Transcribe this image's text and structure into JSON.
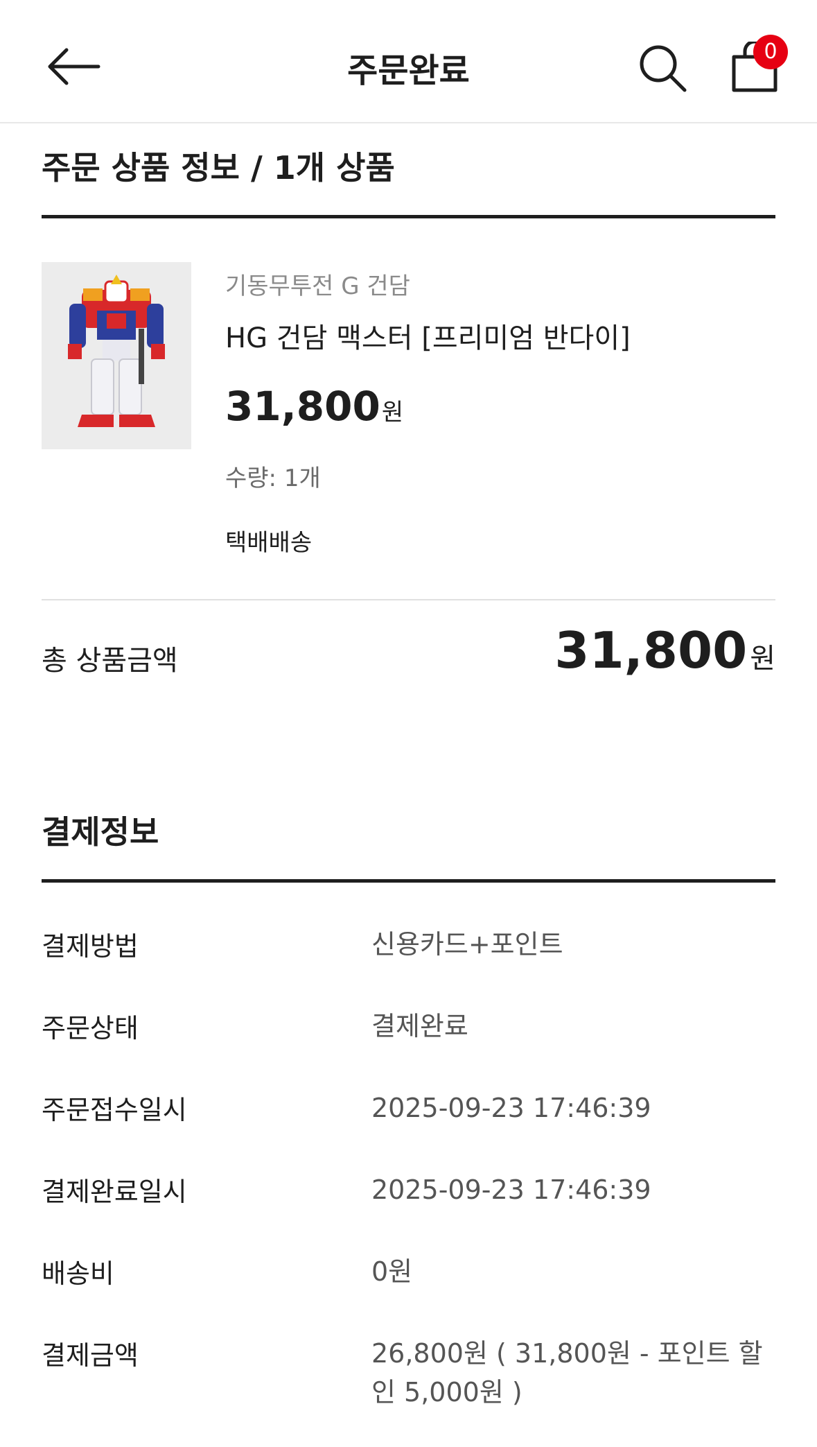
{
  "header": {
    "title": "주문완료",
    "cart_count": "0",
    "back_icon": "arrow-left-icon",
    "search_icon": "search-icon",
    "cart_icon": "shopping-bag-icon",
    "badge_color": "#e60012"
  },
  "order_section": {
    "title": "주문 상품 정보 / 1개 상품",
    "product": {
      "brand": "기동무투전 G 건담",
      "name": "HG 건담 맥스터 [프리미엄 반다이]",
      "price": "31,800",
      "price_unit": "원",
      "quantity": "수량: 1개",
      "shipping": "택배배송"
    },
    "total_label": "총 상품금액",
    "total_amount": "31,800",
    "total_unit": "원"
  },
  "payment_section": {
    "title": "결제정보",
    "rows": [
      {
        "label": "결제방법",
        "value": "신용카드+포인트"
      },
      {
        "label": "주문상태",
        "value": "결제완료"
      },
      {
        "label": "주문접수일시",
        "value": "2025-09-23 17:46:39"
      },
      {
        "label": "결제완료일시",
        "value": "2025-09-23 17:46:39"
      },
      {
        "label": "배송비",
        "value": "0원"
      },
      {
        "label": "결제금액",
        "value": "26,800원 ( 31,800원 - 포인트 할인 5,000원 )"
      }
    ]
  }
}
